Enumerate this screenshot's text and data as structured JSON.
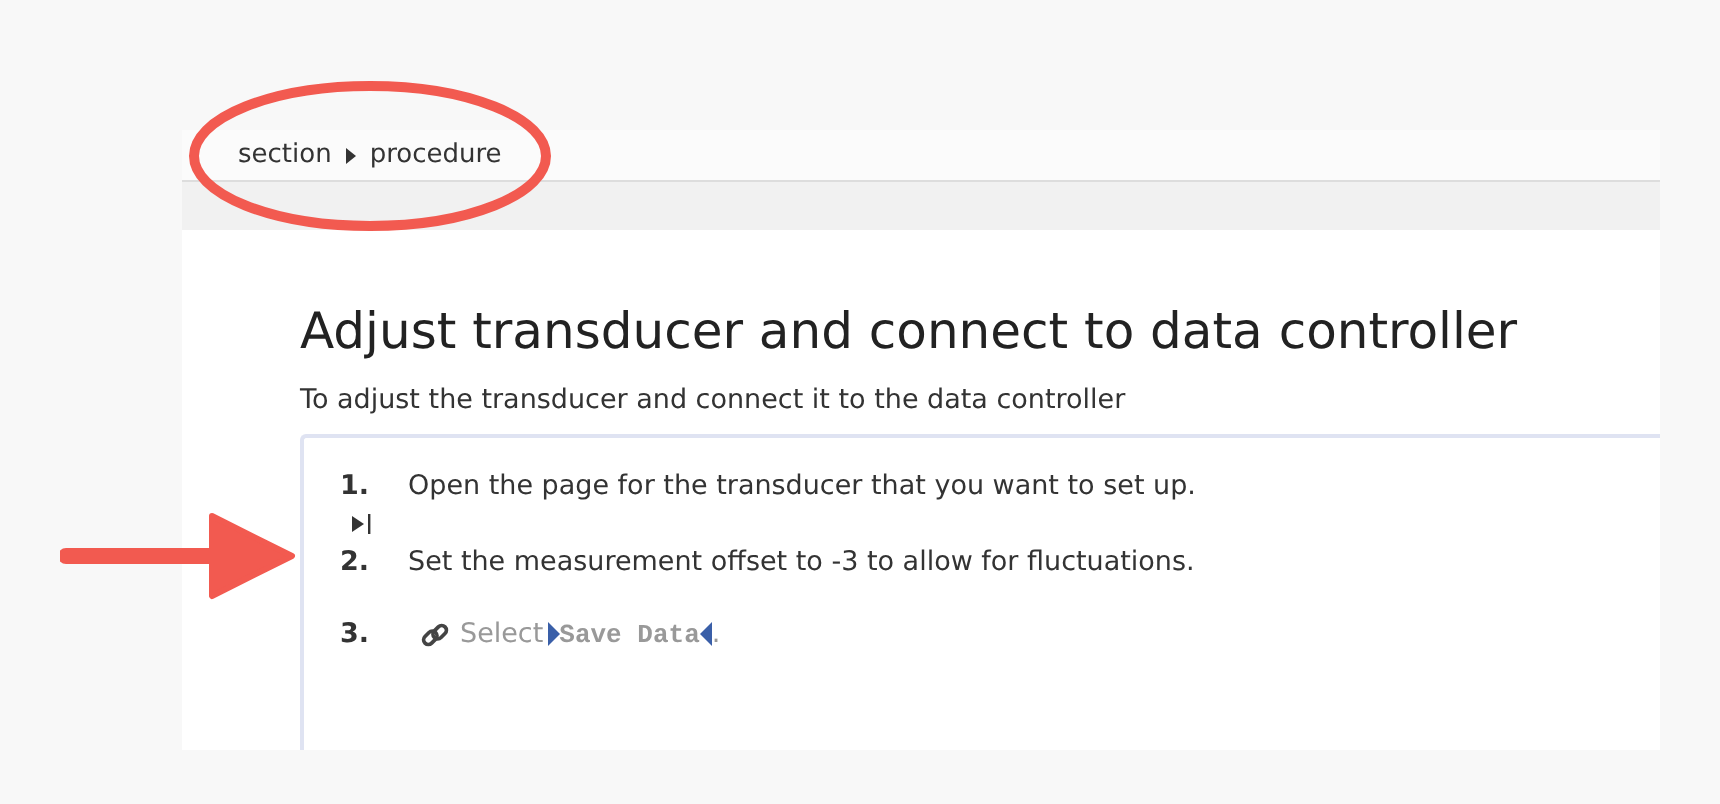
{
  "breadcrumb": [
    {
      "label": "section"
    },
    {
      "label": "procedure"
    }
  ],
  "title": "Adjust transducer and connect to data controller",
  "intro": "To adjust the transducer and connect it to the data controller",
  "steps": [
    {
      "kind": "text",
      "number": "1.",
      "text": "Open the page for the transducer that you want to set up."
    },
    {
      "kind": "marker"
    },
    {
      "kind": "text",
      "number": "2.",
      "text": "Set the measurement offset to -3 to allow for fluctuations."
    },
    {
      "kind": "reference",
      "number": "3.",
      "text": "Select",
      "ref": "Save Data",
      "end": "."
    }
  ]
}
